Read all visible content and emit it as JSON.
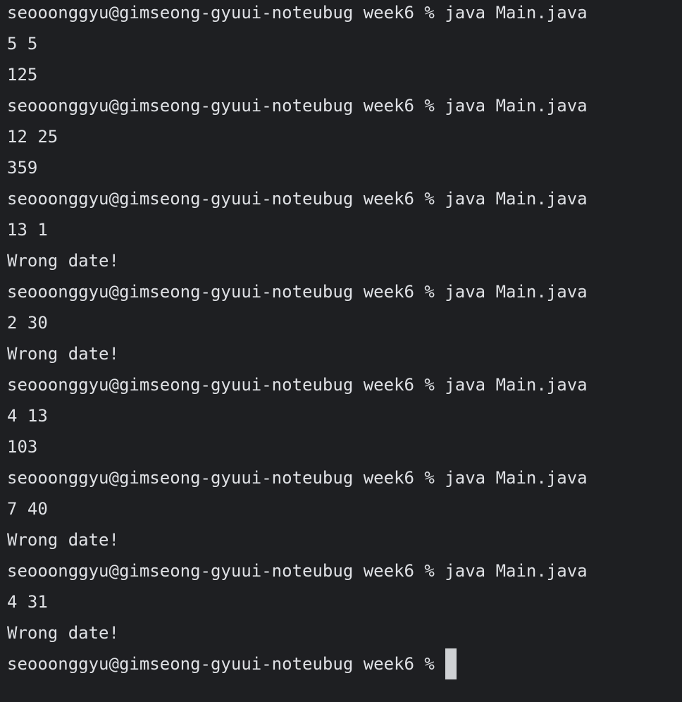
{
  "terminal": {
    "lines": [
      "seooonggyu@gimseong-gyuui-noteubug week6 % java Main.java",
      "5 5",
      "125",
      "seooonggyu@gimseong-gyuui-noteubug week6 % java Main.java",
      "12 25",
      "359",
      "seooonggyu@gimseong-gyuui-noteubug week6 % java Main.java",
      "13 1",
      "Wrong date!",
      "seooonggyu@gimseong-gyuui-noteubug week6 % java Main.java",
      "2 30",
      "Wrong date!",
      "seooonggyu@gimseong-gyuui-noteubug week6 % java Main.java",
      "4 13",
      "103",
      "seooonggyu@gimseong-gyuui-noteubug week6 % java Main.java",
      "7 40",
      "Wrong date!",
      "seooonggyu@gimseong-gyuui-noteubug week6 % java Main.java",
      "4 31",
      "Wrong date!"
    ],
    "prompt": "seooonggyu@gimseong-gyuui-noteubug week6 %"
  },
  "colors": {
    "background": "#1e1f22",
    "text": "#dfe1e5",
    "cursor": "#cfd1d4"
  }
}
